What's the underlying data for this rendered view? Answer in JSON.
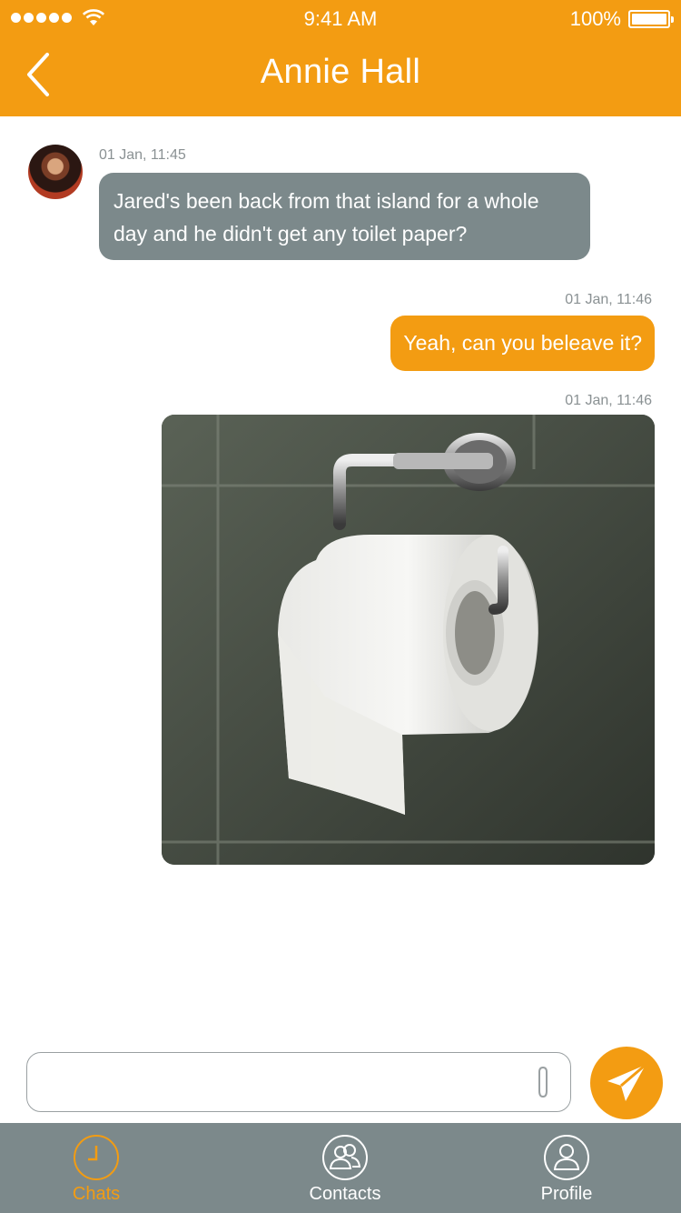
{
  "status_bar": {
    "time": "9:41 AM",
    "battery_percent": "100%",
    "signal_bars": 5,
    "wifi_icon": "wifi-icon",
    "battery_level": 1.0
  },
  "nav": {
    "back_icon": "chevron-left-icon",
    "title": "Annie Hall"
  },
  "messages": [
    {
      "direction": "incoming",
      "timestamp": "01 Jan, 11:45",
      "text": "Jared's been back from that island for a whole day and he didn't get any toilet paper?",
      "has_avatar": true
    },
    {
      "direction": "outgoing",
      "timestamp": "01 Jan, 11:46",
      "text": "Yeah, can you beleave it?"
    },
    {
      "direction": "outgoing",
      "timestamp": "01 Jan, 11:46",
      "type": "image",
      "image_subject": "toilet paper roll on wall holder"
    }
  ],
  "composer": {
    "value": "",
    "placeholder": "",
    "attach_icon": "paperclip-icon",
    "send_icon": "paper-plane-icon"
  },
  "tabbar": {
    "tabs": [
      {
        "label": "Chats",
        "icon": "clock-icon",
        "active": true
      },
      {
        "label": "Contacts",
        "icon": "contacts-icon",
        "active": false
      },
      {
        "label": "Profile",
        "icon": "profile-icon",
        "active": false
      }
    ]
  },
  "colors": {
    "accent": "#f39c12",
    "incoming_bubble": "#7c898b",
    "tabbar": "#7c898b",
    "timestamp": "#8a9193"
  }
}
